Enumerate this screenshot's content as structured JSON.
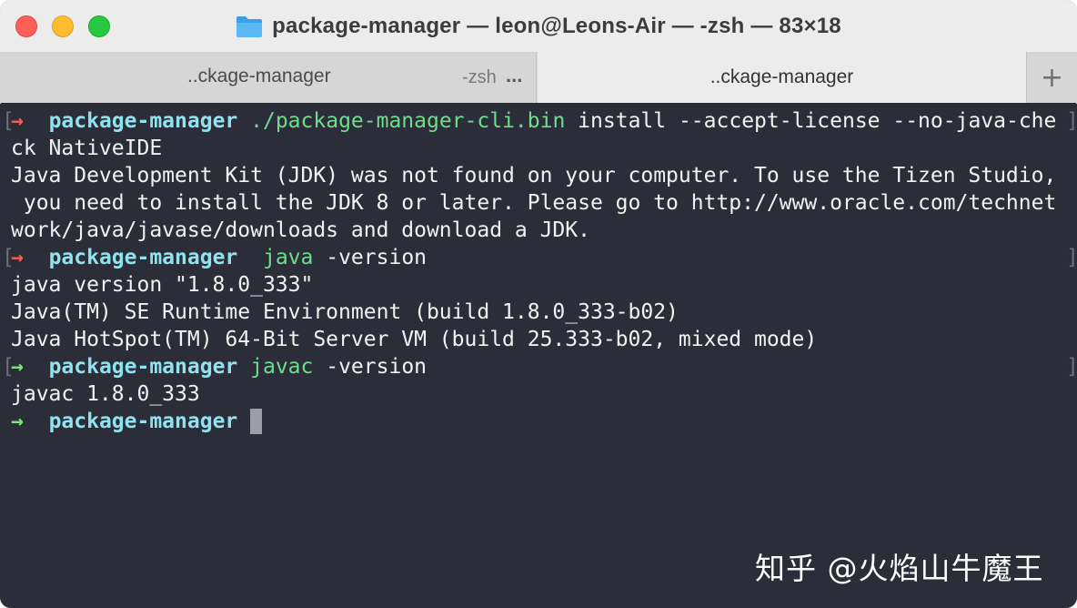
{
  "window": {
    "title": "package-manager — leon@Leons-Air — -zsh — 83×18",
    "title_icon": "folder-icon"
  },
  "tabs": [
    {
      "label": "..ckage-manager",
      "sub": "-zsh",
      "more": "...",
      "active": false
    },
    {
      "label": "..ckage-manager",
      "active": true
    }
  ],
  "new_tab_label": "+",
  "terminal": {
    "prompt_arrow": "→",
    "lines": [
      {
        "kind": "prompt",
        "arrow_color": "red",
        "dir": "package-manager",
        "cmd": "./package-manager-cli.bin",
        "args": " install --accept-license --no-java-che",
        "bracket": true
      },
      {
        "kind": "output",
        "text": "ck NativeIDE"
      },
      {
        "kind": "output",
        "text": "Java Development Kit (JDK) was not found on your computer. To use the Tizen Studio,"
      },
      {
        "kind": "output",
        "text": " you need to install the JDK 8 or later. Please go to http://www.oracle.com/technet"
      },
      {
        "kind": "output",
        "text": "work/java/javase/downloads and download a JDK."
      },
      {
        "kind": "prompt",
        "arrow_color": "red",
        "dir": "package-manager",
        "cmd": " java",
        "args": " -version",
        "bracket": true
      },
      {
        "kind": "output",
        "text": "java version \"1.8.0_333\""
      },
      {
        "kind": "output",
        "text": "Java(TM) SE Runtime Environment (build 1.8.0_333-b02)"
      },
      {
        "kind": "output",
        "text": "Java HotSpot(TM) 64-Bit Server VM (build 25.333-b02, mixed mode)"
      },
      {
        "kind": "prompt",
        "arrow_color": "green",
        "dir": "package-manager",
        "cmd": "javac",
        "args": " -version",
        "bracket": true
      },
      {
        "kind": "output",
        "text": "javac 1.8.0_333"
      },
      {
        "kind": "prompt",
        "arrow_color": "green",
        "dir": "package-manager",
        "cmd": "",
        "args": "",
        "bracket": false,
        "cursor": true
      }
    ]
  },
  "watermark": "知乎 @火焰山牛魔王",
  "colors": {
    "background": "#2b2e38",
    "prompt_dir": "#8fe3ef",
    "command": "#6fde8c",
    "arrow_red": "#f0605a",
    "arrow_green": "#7ee07e"
  }
}
